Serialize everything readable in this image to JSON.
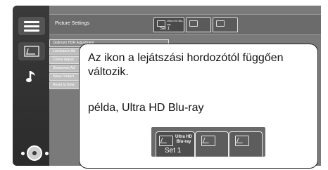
{
  "sidebar": {
    "items": [
      {
        "name": "menu-icon"
      },
      {
        "name": "picture-icon"
      },
      {
        "name": "music-note-icon"
      }
    ],
    "nav": {
      "name": "dpad-icon"
    }
  },
  "panel": {
    "title": "Picture Settings",
    "header_tabs": [
      {
        "label": "Ultra HD Blu-ray",
        "set": "Set 1",
        "selected": true
      },
      {
        "label": "",
        "set": "",
        "selected": false
      },
      {
        "label": "",
        "set": "",
        "selected": false
      }
    ],
    "settings": [
      "Optimum HDR Adjustment",
      "Luminance Ad",
      "Colour Adjust",
      "Sharpness Ad",
      "Noise Reduct",
      "Reset to Defa"
    ]
  },
  "callout": {
    "text": "Az ikon a lejátszási hordozótól függően változik.",
    "example": "példa, Ultra HD Blu-ray",
    "example_tab_label": "Ultra HD Blu-ray",
    "example_tab_set": "Set 1"
  },
  "colors": {
    "panel": "#7a7a7a",
    "sidebar": "#2e2e2e",
    "callout_border": "#222222"
  }
}
